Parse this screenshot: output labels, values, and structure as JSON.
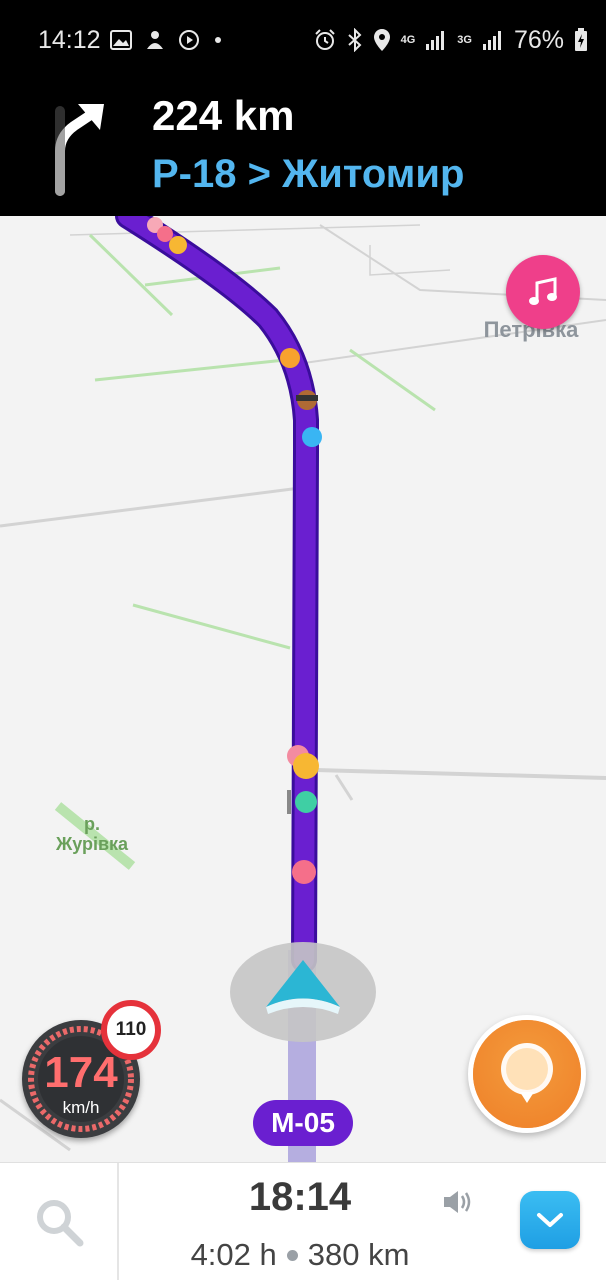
{
  "status_bar": {
    "time": "14:12",
    "network_1": "4G",
    "network_2": "3G",
    "battery": "76%"
  },
  "navigation": {
    "distance": "224 km",
    "street": "Р-18 > Житомир",
    "turn_icon": "turn-right-arrow-icon"
  },
  "map": {
    "place_label": "Пі\nПетрівка",
    "river_label": "р.\nЖурівка",
    "road_shield": "М-05",
    "route_color": "#6a1fd0"
  },
  "speedometer": {
    "speed": "174",
    "unit": "km/h",
    "speed_limit": "110",
    "speed_color": "#ff6e6e"
  },
  "bottom_bar": {
    "eta": "18:14",
    "duration": "4:02 h",
    "distance_remaining": "380 km"
  },
  "icons": {
    "music": "music-note-icon",
    "report": "report-pin-icon",
    "search": "search-icon",
    "sound": "speaker-icon",
    "expand": "chevron-down-icon"
  }
}
